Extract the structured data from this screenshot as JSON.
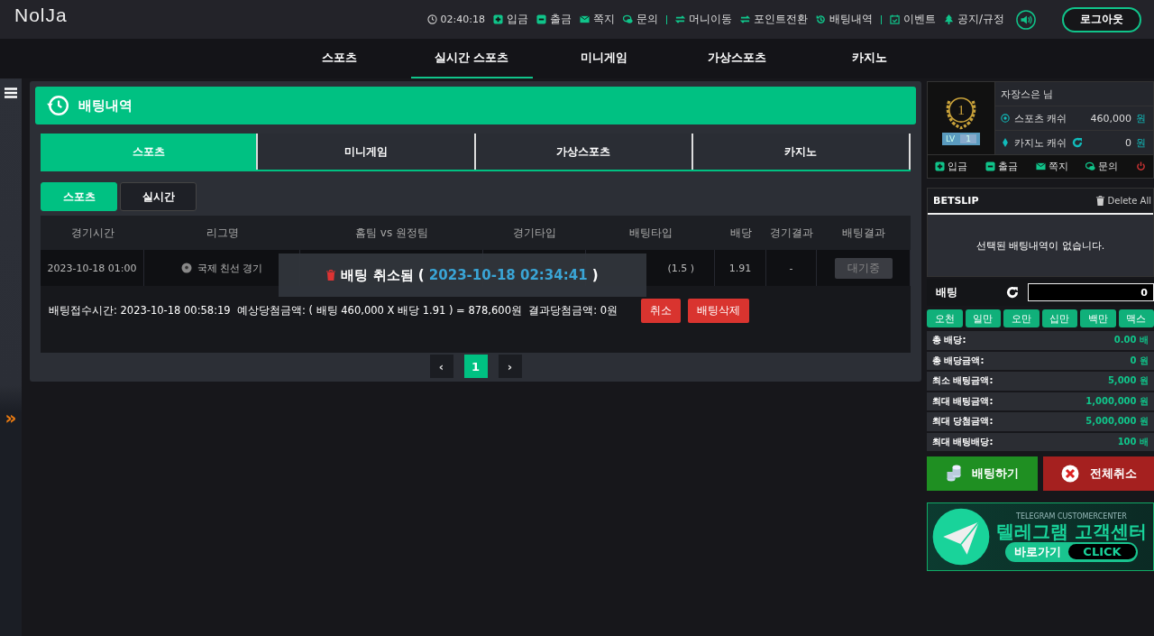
{
  "header": {
    "logo": "NolJa",
    "time": "02:40:18",
    "link_groups": [
      [
        {
          "kind": "plus",
          "label": "입금"
        },
        {
          "kind": "minus",
          "label": "출금"
        },
        {
          "kind": "mail",
          "label": "쪽지"
        },
        {
          "kind": "chat",
          "label": "문의"
        }
      ],
      [
        {
          "kind": "swap",
          "label": "머니이동"
        },
        {
          "kind": "swap",
          "label": "포인트전환"
        },
        {
          "kind": "history",
          "label": "배팅내역"
        }
      ],
      [
        {
          "kind": "calendar",
          "label": "이벤트"
        },
        {
          "kind": "tree",
          "label": "공지/규정"
        }
      ]
    ],
    "logout": "로그아웃"
  },
  "nav": [
    {
      "label": "스포츠",
      "selected": false
    },
    {
      "label": "실시간 스포츠",
      "selected": true
    },
    {
      "label": "미니게임",
      "selected": false
    },
    {
      "label": "가상스포츠",
      "selected": false
    },
    {
      "label": "카지노",
      "selected": false
    }
  ],
  "sidebar": {
    "toggle": "»"
  },
  "panel": {
    "title": "배팅내역",
    "tabs": [
      {
        "label": "스포츠",
        "selected": true
      },
      {
        "label": "미니게임",
        "selected": false
      },
      {
        "label": "가상스포츠",
        "selected": false
      },
      {
        "label": "카지노",
        "selected": false
      }
    ],
    "subtabs": [
      {
        "label": "스포츠",
        "selected": true
      },
      {
        "label": "실시간",
        "selected": false
      }
    ],
    "table": {
      "columns": [
        "경기시간",
        "리그명",
        "홈팀 vs 원정팀",
        "경기타입",
        "배팅타입",
        "배당",
        "경기결과",
        "배팅결과"
      ],
      "rows": [
        {
          "time": "2023-10-18 01:00",
          "league": "국제 친선 경기",
          "bet_type": "(1.5 )",
          "odds": "1.91",
          "result": "-",
          "status": "대기중"
        }
      ],
      "summary": "배팅접수시간: 2023-10-18 00:58:19  예상당첨금액: ( 배팅 460,000 X 배당 1.91 ) = 878,600원  결과당첨금액: 0원",
      "actions": [
        "취소",
        "배팅삭제"
      ]
    },
    "pagination": {
      "prev": "‹",
      "pages": [
        {
          "label": "1",
          "selected": true
        }
      ],
      "next": "›"
    },
    "toast": {
      "text": "배팅 취소됨",
      "open": "(",
      "date": "2023-10-18 02:34:41",
      "close": ")"
    }
  },
  "account": {
    "level_badge": "1",
    "level_label": "LV",
    "level_value": "1",
    "name": "자장스은 님",
    "sports_cash_label": "스포츠 캐쉬",
    "sports_cash": "460,000",
    "sports_currency": "원",
    "casino_cash_label": "카지노 캐쉬",
    "casino_cash": "0",
    "casino_currency": "원",
    "actions": [
      {
        "kind": "plus",
        "label": "입금"
      },
      {
        "kind": "minus",
        "label": "출금"
      },
      {
        "kind": "mail",
        "label": "쪽지"
      },
      {
        "kind": "chat",
        "label": "문의"
      }
    ]
  },
  "betslip": {
    "title": "BETSLIP",
    "delete_all": "Delete All",
    "empty": "선택된 배팅내역이 없습니다.",
    "bet_label": "배팅",
    "amount": "0",
    "quick": [
      "오천",
      "일만",
      "오만",
      "십만",
      "백만",
      "맥스"
    ],
    "stats": [
      {
        "label": "총 배당:",
        "value": "0.00 배"
      },
      {
        "label": "총 배당금액:",
        "value": "0 원"
      },
      {
        "label": "최소 배팅금액:",
        "value": "5,000 원"
      },
      {
        "label": "최대 배팅금액:",
        "value": "1,000,000 원"
      },
      {
        "label": "최대 당첨금액:",
        "value": "5,000,000 원"
      },
      {
        "label": "최대 배팅배당:",
        "value": "100 배"
      }
    ],
    "place": "배팅하기",
    "cancel_all": "전체취소"
  },
  "banner": {
    "subtitle": "TELEGRAM CUSTOMERCENTER",
    "title": "텔레그램 고객센터",
    "go": "바로가기",
    "click": "CLICK"
  }
}
